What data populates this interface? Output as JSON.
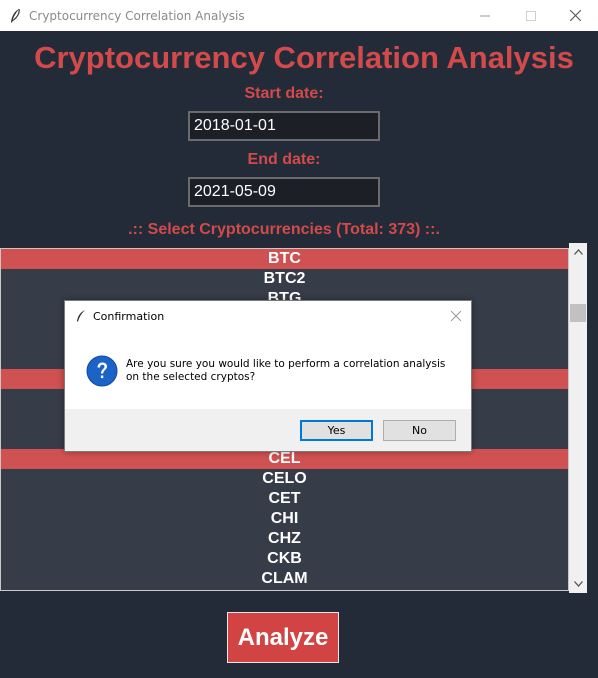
{
  "window": {
    "title": "Cryptocurrency Correlation Analysis",
    "icon": "feather-icon",
    "controls": [
      "minimize-icon",
      "maximize-icon",
      "close-icon"
    ]
  },
  "app": {
    "heading": "Cryptocurrency Correlation Analysis",
    "start_label": "Start date:",
    "start_value": "2018-01-01",
    "end_label": "End date:",
    "end_value": "2021-05-09",
    "select_label": ".:: Select Cryptocurrencies (Total: 373) ::.",
    "analyze_label": "Analyze",
    "colors": {
      "background": "#232b39",
      "accent": "#d24a4a",
      "list_bg": "#363c48",
      "selected_row": "#d05151"
    }
  },
  "listbox": {
    "items": [
      {
        "label": "BTC",
        "selected": true
      },
      {
        "label": "BTC2",
        "selected": false
      },
      {
        "label": "BTG",
        "selected": false
      },
      {
        "label": "",
        "selected": false
      },
      {
        "label": "",
        "selected": false
      },
      {
        "label": "",
        "selected": false
      },
      {
        "label": "",
        "selected": true
      },
      {
        "label": "",
        "selected": false
      },
      {
        "label": "",
        "selected": false
      },
      {
        "label": "",
        "selected": false
      },
      {
        "label": "CEL",
        "selected": true
      },
      {
        "label": "CELO",
        "selected": false
      },
      {
        "label": "CET",
        "selected": false
      },
      {
        "label": "CHI",
        "selected": false
      },
      {
        "label": "CHZ",
        "selected": false
      },
      {
        "label": "CKB",
        "selected": false
      },
      {
        "label": "CLAM",
        "selected": false
      }
    ]
  },
  "dialog": {
    "title": "Confirmation",
    "icon": "question-icon",
    "message_line1": "Are you sure you would like to perform a correlation analysis",
    "message_line2": "on the selected cryptos?",
    "yes_label": "Yes",
    "no_label": "No"
  }
}
